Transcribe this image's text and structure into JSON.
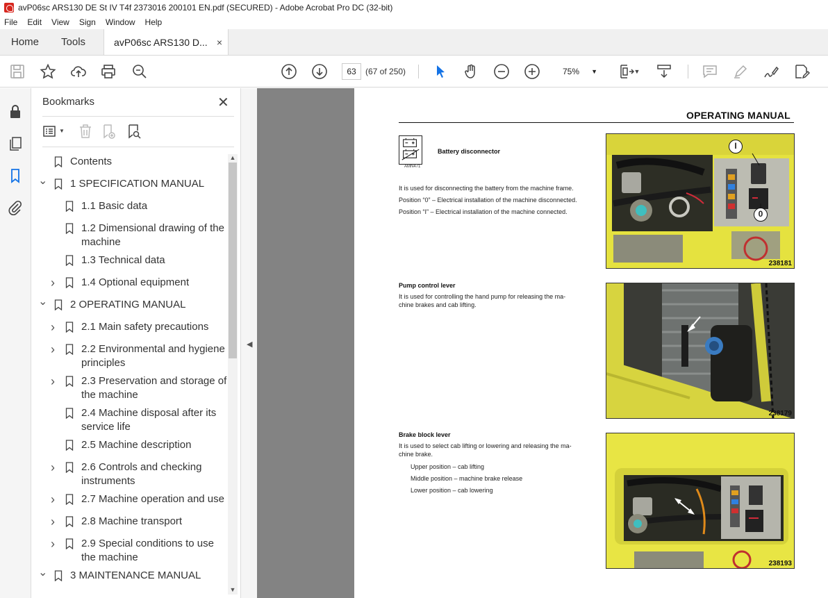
{
  "window": {
    "title": "avP06sc ARS130 DE St IV T4f 2373016 200101 EN.pdf (SECURED) - Adobe Acrobat Pro DC (32-bit)"
  },
  "menu": [
    "File",
    "Edit",
    "View",
    "Sign",
    "Window",
    "Help"
  ],
  "tabs": {
    "home": "Home",
    "tools": "Tools",
    "document": "avP06sc ARS130 D...",
    "close": "×"
  },
  "toolbar": {
    "page_number": "63",
    "page_count": "(67 of 250)",
    "zoom": "75%"
  },
  "bookmarks": {
    "title": "Bookmarks",
    "close": "✕",
    "items": [
      {
        "label": "Contents",
        "level": 0,
        "chevron": ""
      },
      {
        "label": "1 SPECIFICATION MANUAL",
        "level": 0,
        "chevron": "down"
      },
      {
        "label": "1.1 Basic data",
        "level": 1,
        "chevron": ""
      },
      {
        "label": "1.2 Dimensional drawing of the",
        "label2": "machine",
        "level": 1,
        "chevron": ""
      },
      {
        "label": "1.3 Technical data",
        "level": 1,
        "chevron": ""
      },
      {
        "label": "1.4 Optional equipment",
        "level": 1,
        "chevron": "right"
      },
      {
        "label": "2 OPERATING MANUAL",
        "level": 0,
        "chevron": "down"
      },
      {
        "label": "2.1 Main safety precautions",
        "level": 1,
        "chevron": "right"
      },
      {
        "label": "2.2 Environmental and hygiene",
        "label2": "principles",
        "level": 1,
        "chevron": "right"
      },
      {
        "label": "2.3 Preservation and storage of",
        "label2": "the machine",
        "level": 1,
        "chevron": "right"
      },
      {
        "label": "2.4 Machine disposal after its",
        "label2": "service life",
        "level": 1,
        "chevron": ""
      },
      {
        "label": "2.5 Machine description",
        "level": 1,
        "chevron": ""
      },
      {
        "label": "2.6 Controls and checking",
        "label2": "instruments",
        "level": 1,
        "chevron": "right"
      },
      {
        "label": "2.7 Machine operation and use",
        "level": 1,
        "chevron": "right"
      },
      {
        "label": "2.8 Machine transport",
        "level": 1,
        "chevron": "right"
      },
      {
        "label": "2.9 Special conditions to use",
        "label2": "the machine",
        "level": 1,
        "chevron": "right"
      },
      {
        "label": "3 MAINTENANCE MANUAL",
        "level": 0,
        "chevron": "down"
      }
    ]
  },
  "page": {
    "header": "OPERATING MANUAL",
    "symbol_label": "AMN471",
    "sections": [
      {
        "heading": "Battery disconnector",
        "lines": [
          "It is used for disconnecting the battery from the machine frame.",
          "Position “0” – Electrical installation of the machine disconnected.",
          "Position “I” – Electrical installation of the machine connected."
        ],
        "photo_number": "238181",
        "callouts": [
          "I",
          "0"
        ]
      },
      {
        "heading": "Pump control lever",
        "lines": [
          "It is used for controlling the hand pump for releasing the ma-",
          "chine brakes and cab lifting."
        ],
        "photo_number": "238179"
      },
      {
        "heading": "Brake block lever",
        "lines": [
          "It is used to select cab lifting or lowering and releasing the ma-",
          "chine brake."
        ],
        "sub_lines": [
          "Upper position – cab lifting",
          "Middle position – machine brake release",
          "Lower position – cab lowering"
        ],
        "photo_number": "238193"
      }
    ]
  }
}
